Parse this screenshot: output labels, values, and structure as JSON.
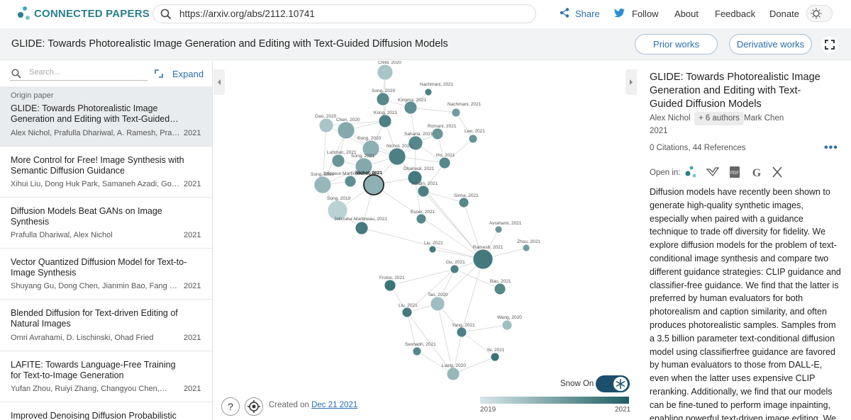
{
  "header": {
    "brand": "CONNECTED PAPERS",
    "url": "https://arxiv.org/abs/2112.10741",
    "nav": {
      "share": "Share",
      "follow": "Follow",
      "about": "About",
      "feedback": "Feedback",
      "donate": "Donate"
    }
  },
  "titlebar": {
    "title": "GLIDE: Towards Photorealistic Image Generation and Editing with Text-Guided Diffusion Models",
    "prior": "Prior works",
    "derivative": "Derivative works"
  },
  "sidebar": {
    "search_placeholder": "Search...",
    "expand": "Expand",
    "origin_label": "Origin paper",
    "items": [
      {
        "title": "GLIDE: Towards Photorealistic Image Generation and Editing with Text-Guided…",
        "authors": "Alex Nichol, Prafulla Dhariwal, A. Ramesh, Prana…",
        "year": "2021"
      },
      {
        "title": "More Control for Free! Image Synthesis with Semantic Diffusion Guidance",
        "authors": "Xihui Liu, Dong Huk Park, Samaneh Azadi, Gong…",
        "year": "2021"
      },
      {
        "title": "Diffusion Models Beat GANs on Image Synthesis",
        "authors": "Prafulla Dhariwal, Alex Nichol",
        "year": "2021"
      },
      {
        "title": "Vector Quantized Diffusion Model for Text-to-Image Synthesis",
        "authors": "Shuyang Gu, Dong Chen, Jianmin Bao, Fang Wen,…",
        "year": "2021"
      },
      {
        "title": "Blended Diffusion for Text-driven Editing of Natural Images",
        "authors": "Omri Avrahami, D. Lischinski, Ohad Fried",
        "year": "2021"
      },
      {
        "title": "LAFITE: Towards Language-Free Training for Text-to-Image Generation",
        "authors": "Yufan Zhou, Ruiyi Zhang, Changyou Chen,…",
        "year": "2021"
      },
      {
        "title": "Improved Denoising Diffusion Probabilistic",
        "authors": "",
        "year": ""
      }
    ]
  },
  "graph": {
    "nodes": [
      {
        "label": "Child, 2020"
      },
      {
        "label": "Song, 2020"
      },
      {
        "label": "Nachmani, 2021"
      },
      {
        "label": "Kingma, 2021"
      },
      {
        "label": "Nachmani, 2021"
      },
      {
        "label": "Kong, 2021"
      },
      {
        "label": "Gao, 2020"
      },
      {
        "label": "Chen, 2020"
      },
      {
        "label": "Romani, 2021"
      },
      {
        "label": "Saharia, 2021"
      },
      {
        "label": "Lee, 2021"
      },
      {
        "label": "Kong, 2020"
      },
      {
        "label": "Nichol, 2021"
      },
      {
        "label": "Ho, 2021"
      },
      {
        "label": "Luhman, 2021"
      },
      {
        "label": "Song, 2021"
      },
      {
        "label": "Jolicoeur-Martineau, 2021"
      },
      {
        "label": "Dhariwal, 2021"
      },
      {
        "label": "Song, 2020"
      },
      {
        "label": "Nichol, 2021"
      },
      {
        "label": "Austin, 2021"
      },
      {
        "label": "Sinha, 2021"
      },
      {
        "label": "Song, 2019"
      },
      {
        "label": "Esser, 2021"
      },
      {
        "label": "Jolicoeur-Martineau, 2021"
      },
      {
        "label": "Avrahami, 2021"
      },
      {
        "label": "Zhou, 2021"
      },
      {
        "label": "Liu, 2021"
      },
      {
        "label": "Ramesh, 2021"
      },
      {
        "label": "Gu, 2021"
      },
      {
        "label": "Frolov, 2021"
      },
      {
        "label": "Bau, 2021"
      },
      {
        "label": "Tao, 2020"
      },
      {
        "label": "Liu, 2021"
      },
      {
        "label": "Wang, 2020"
      },
      {
        "label": "Yang, 2021"
      },
      {
        "label": "Seshadri, 2021"
      },
      {
        "label": "Ye, 2021"
      },
      {
        "label": "Liang, 2020"
      }
    ],
    "snow_label": "Snow On",
    "created_prefix": "Created on ",
    "created_date": "Dec 21 2021",
    "gradient_start": "2019",
    "gradient_end": "2021",
    "help": "?"
  },
  "detail": {
    "title": "GLIDE: Towards Photorealistic Image Generation and Editing with Text-Guided Diffusion Models",
    "author_first": "Alex Nichol",
    "more_authors": "+ 6 authors",
    "author_last": "Mark Chen",
    "year": "2021",
    "citations": "0 Citations, 44 References",
    "open_in": "Open in:",
    "abstract": "Diffusion models have recently been shown to generate high-quality synthetic images, especially when paired with a guidance technique to trade off diversity for fidelity. We explore diffusion models for the problem of text-conditional image synthesis and compare two different guidance strategies: CLIP guidance and classifier-free guidance. We find that the latter is preferred by human evaluators for both photorealism and caption similarity, and often produces photorealistic samples. Samples from a 3.5 billion parameter text-conditional diffusion model using classifierfree guidance are favored by human evaluators to those from DALL-E, even when the latter uses expensive CLIP reranking. Additionally, we find that our models can be fine-tuned to perform image inpainting, enabling powerful text-driven image editing. We train a"
  },
  "colors": {
    "brand": "#2a7f8a",
    "link": "#2a6fb0",
    "dark_node": "#2d6b6e",
    "light_node": "#cfe1e3"
  }
}
